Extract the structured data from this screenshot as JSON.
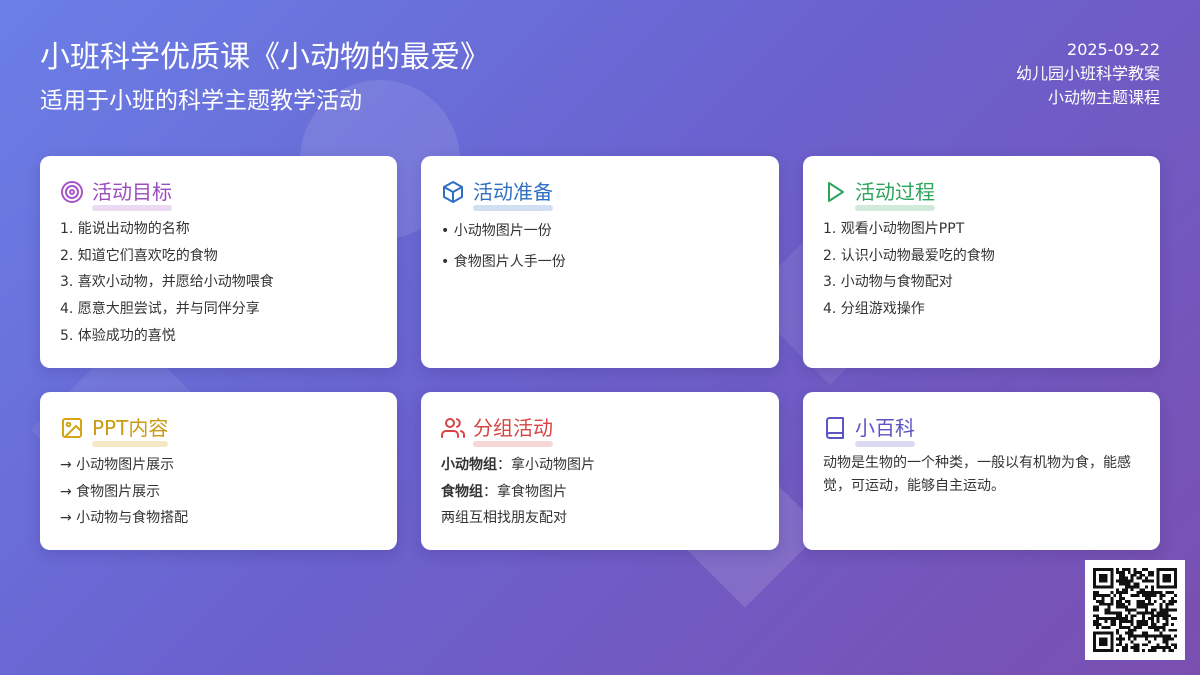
{
  "header": {
    "title": "小班科学优质课《小动物的最爱》",
    "subtitle": "适用于小班的科学主题教学活动",
    "date": "2025-09-22",
    "meta_line1": "幼儿园小班科学教案",
    "meta_line2": "小动物主题课程"
  },
  "colors": {
    "background_start": "#6a7fe6",
    "background_end": "#7a4fb0",
    "goals": "#9b4dbf",
    "prep": "#2f6fc4",
    "process": "#2ea45c",
    "ppt": "#c99a12",
    "group": "#d64545",
    "wiki": "#5b54c4"
  },
  "cards": {
    "goals": {
      "icon": "target-icon",
      "title": "活动目标",
      "items": [
        "1. 能说出动物的名称",
        "2. 知道它们喜欢吃的食物",
        "3. 喜欢小动物，并愿给小动物喂食",
        "4. 愿意大胆尝试，并与同伴分享",
        "5. 体验成功的喜悦"
      ]
    },
    "prep": {
      "icon": "cube-icon",
      "title": "活动准备",
      "items": [
        "• 小动物图片一份",
        "• 食物图片人手一份"
      ]
    },
    "process": {
      "icon": "play-icon",
      "title": "活动过程",
      "items": [
        "1. 观看小动物图片PPT",
        "2. 认识小动物最爱吃的食物",
        "3. 小动物与食物配对",
        "4. 分组游戏操作"
      ]
    },
    "ppt": {
      "icon": "image-icon",
      "title": "PPT内容",
      "items": [
        "→ 小动物图片展示",
        "→ 食物图片展示",
        "→ 小动物与食物搭配"
      ]
    },
    "group": {
      "icon": "users-icon",
      "title": "分组活动",
      "line1_label": "小动物组",
      "line1_text": "：拿小动物图片",
      "line2_label": "食物组",
      "line2_text": "：拿食物图片",
      "line3": "两组互相找朋友配对"
    },
    "wiki": {
      "icon": "book-icon",
      "title": "小百科",
      "text": "动物是生物的一个种类，一般以有机物为食，能感觉，可运动，能够自主运动。"
    }
  },
  "qr": {
    "icon": "qr-code-icon"
  }
}
